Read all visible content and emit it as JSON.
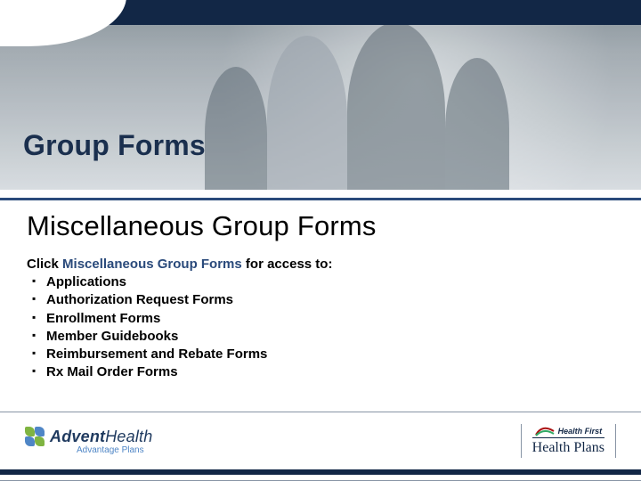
{
  "hero": {
    "title": "Group Forms"
  },
  "content": {
    "title": "Miscellaneous Group Forms",
    "lead_prefix": "Click ",
    "lead_link": "Miscellaneous Group Forms",
    "lead_suffix": " for access to:",
    "items": [
      "Applications",
      "Authorization Request Forms",
      "Enrollment Forms",
      "Member Guidebooks",
      "Reimbursement and Rebate Forms",
      "Rx Mail Order Forms"
    ]
  },
  "footer": {
    "advent": {
      "word_a": "Advent",
      "word_b": "Health",
      "sub": "Advantage Plans"
    },
    "hf": {
      "brand": "Health First",
      "main": "Health Plans"
    }
  }
}
